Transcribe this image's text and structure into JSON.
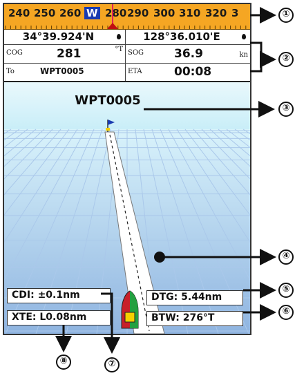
{
  "compass": {
    "labels": [
      "240",
      "250",
      "260",
      "W",
      "280",
      "290",
      "300",
      "310",
      "320",
      "3"
    ],
    "cardinal_index": 3
  },
  "position": {
    "lat": "34°39.924'N",
    "lon": "128°36.010'E"
  },
  "nav": {
    "cog_label": "COG",
    "cog_value": "281",
    "cog_unit": "°T",
    "sog_label": "SOG",
    "sog_value": "36.9",
    "sog_unit": "kn",
    "to_label": "To",
    "to_value": "WPT0005",
    "eta_label": "ETA",
    "eta_value": "00:08"
  },
  "view": {
    "waypoint_title": "WPT0005",
    "cdi": "CDI: ±0.1nm",
    "xte": "XTE: L0.08nm",
    "dtg": "DTG: 5.44nm",
    "btw": "BTW: 276°T"
  },
  "callouts": [
    "①",
    "②",
    "③",
    "④",
    "⑤",
    "⑥",
    "⑦",
    "⑧"
  ],
  "colors": {
    "compass": "#f5a623",
    "cardinal": "#1a3bb0",
    "heading": "#e0215a",
    "sea_top": "#d9f3fb",
    "sea_bottom": "#8fb4e0"
  }
}
